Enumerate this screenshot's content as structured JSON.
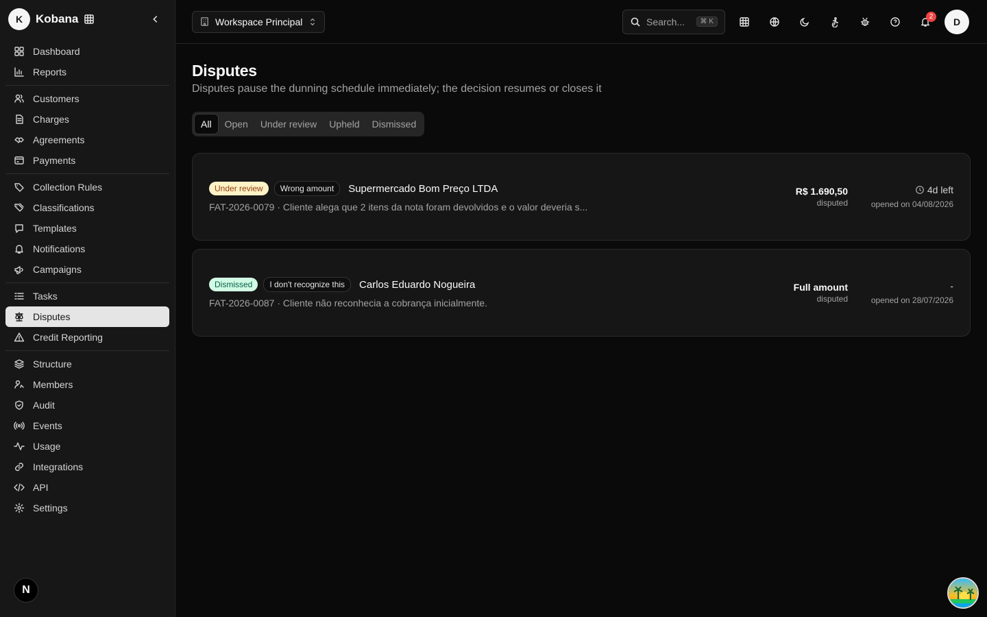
{
  "app": {
    "name": "Kobana",
    "logo_letter": "K"
  },
  "sidebar": {
    "groups": [
      [
        {
          "label": "Dashboard",
          "icon": "dashboard-icon"
        },
        {
          "label": "Reports",
          "icon": "reports-icon"
        }
      ],
      [
        {
          "label": "Customers",
          "icon": "customers-icon"
        },
        {
          "label": "Charges",
          "icon": "charges-icon"
        },
        {
          "label": "Agreements",
          "icon": "agreements-icon"
        },
        {
          "label": "Payments",
          "icon": "payments-icon"
        }
      ],
      [
        {
          "label": "Collection Rules",
          "icon": "collection-rules-icon"
        },
        {
          "label": "Classifications",
          "icon": "classifications-icon"
        },
        {
          "label": "Templates",
          "icon": "templates-icon"
        },
        {
          "label": "Notifications",
          "icon": "notifications-icon"
        },
        {
          "label": "Campaigns",
          "icon": "campaigns-icon"
        }
      ],
      [
        {
          "label": "Tasks",
          "icon": "tasks-icon"
        },
        {
          "label": "Disputes",
          "icon": "disputes-icon",
          "active": true
        },
        {
          "label": "Credit Reporting",
          "icon": "credit-reporting-icon"
        }
      ],
      [
        {
          "label": "Structure",
          "icon": "structure-icon"
        },
        {
          "label": "Members",
          "icon": "members-icon"
        },
        {
          "label": "Audit",
          "icon": "audit-icon"
        },
        {
          "label": "Events",
          "icon": "events-icon"
        },
        {
          "label": "Usage",
          "icon": "usage-icon"
        },
        {
          "label": "Integrations",
          "icon": "integrations-icon"
        },
        {
          "label": "API",
          "icon": "api-icon"
        },
        {
          "label": "Settings",
          "icon": "settings-icon"
        }
      ]
    ],
    "footer_letter": "N"
  },
  "topbar": {
    "workspace": "Workspace Principal",
    "search_placeholder": "Search...",
    "search_shortcut": "⌘ K",
    "notification_count": "2",
    "user_initial": "D"
  },
  "page": {
    "title": "Disputes",
    "subtitle": "Disputes pause the dunning schedule immediately; the decision resumes or closes it",
    "tabs": [
      "All",
      "Open",
      "Under review",
      "Upheld",
      "Dismissed"
    ],
    "active_tab": "All"
  },
  "disputes": [
    {
      "status": "Under review",
      "status_type": "review",
      "reason": "Wrong amount",
      "customer": "Supermercado Bom Preço LTDA",
      "detail": "FAT-2026-0079 · Cliente alega que 2 itens da nota foram devolvidos e o valor deveria s...",
      "amount": "R$ 1.690,50",
      "amount_label": "disputed",
      "deadline": "4d left",
      "opened": "opened on 04/08/2026"
    },
    {
      "status": "Dismissed",
      "status_type": "dismissed",
      "reason": "I don't recognize this",
      "customer": "Carlos Eduardo Nogueira",
      "detail": "FAT-2026-0087 · Cliente não reconhecia a cobrança inicialmente.",
      "amount": "Full amount",
      "amount_label": "disputed",
      "deadline": "-",
      "opened": "opened on 28/07/2026"
    }
  ]
}
